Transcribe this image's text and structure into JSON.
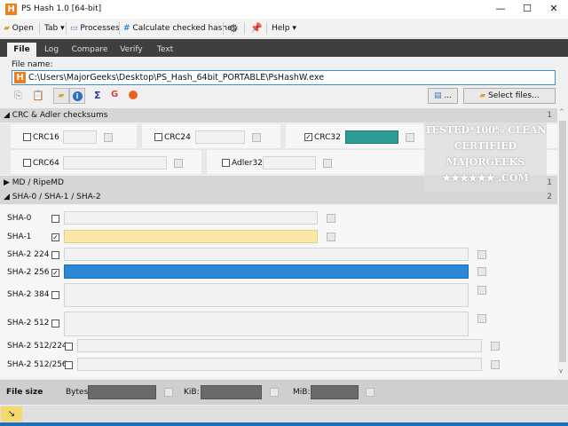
{
  "window": {
    "title": "PS Hash 1.0  [64-bit]",
    "app_icon": "H",
    "minimize": "—",
    "maximize": "☐",
    "close": "✕"
  },
  "toolbar": {
    "open": "Open",
    "tab": "Tab ▾",
    "processes": "Processes",
    "calculate": "Calculate checked hashes",
    "help": "Help ▾"
  },
  "tabs": [
    {
      "label": "File"
    },
    {
      "label": "Log"
    },
    {
      "label": "Compare"
    },
    {
      "label": "Verify"
    },
    {
      "label": "Text"
    }
  ],
  "file": {
    "label": "File name:",
    "value": "C:\\Users\\MajorGeeks\\Desktop\\PS_Hash_64bit_PORTABLE\\PsHashW.exe",
    "edit_button": "...",
    "select_button": "Select files..."
  },
  "crc": {
    "title": "CRC & Adler checksums",
    "count": "1",
    "items": [
      {
        "label": "CRC16",
        "checked": false
      },
      {
        "label": "CRC24",
        "checked": false
      },
      {
        "label": "CRC32",
        "checked": true
      },
      {
        "label": "CRC64",
        "checked": false
      },
      {
        "label": "Adler32",
        "checked": false
      }
    ]
  },
  "md": {
    "title": "MD / RipeMD",
    "count": "1"
  },
  "sha": {
    "title": "SHA-0 / SHA-1 / SHA-2",
    "count": "2",
    "items": [
      {
        "label": "SHA-0",
        "checked": false
      },
      {
        "label": "SHA-1",
        "checked": true
      },
      {
        "label": "SHA-2 224",
        "checked": false
      },
      {
        "label": "SHA-2 256",
        "checked": true
      },
      {
        "label": "SHA-2 384",
        "checked": false
      },
      {
        "label": "SHA-2 512",
        "checked": false
      },
      {
        "label": "SHA-2 512/224",
        "checked": false
      },
      {
        "label": "SHA-2 512/256",
        "checked": false
      }
    ]
  },
  "filesize": {
    "title": "File size",
    "bytes": "Bytes:",
    "kib": "KiB:",
    "mib": "MiB:"
  },
  "watermark": "TESTED *100% CLEAN CERTIFIED MAJORGEEKS .COM",
  "colors": {
    "crc32_fill": "#2e9e94",
    "sha1_fill": "#fbe8a6",
    "sha256_fill": "#2c87d6",
    "tabbar": "#3f3f3f"
  }
}
